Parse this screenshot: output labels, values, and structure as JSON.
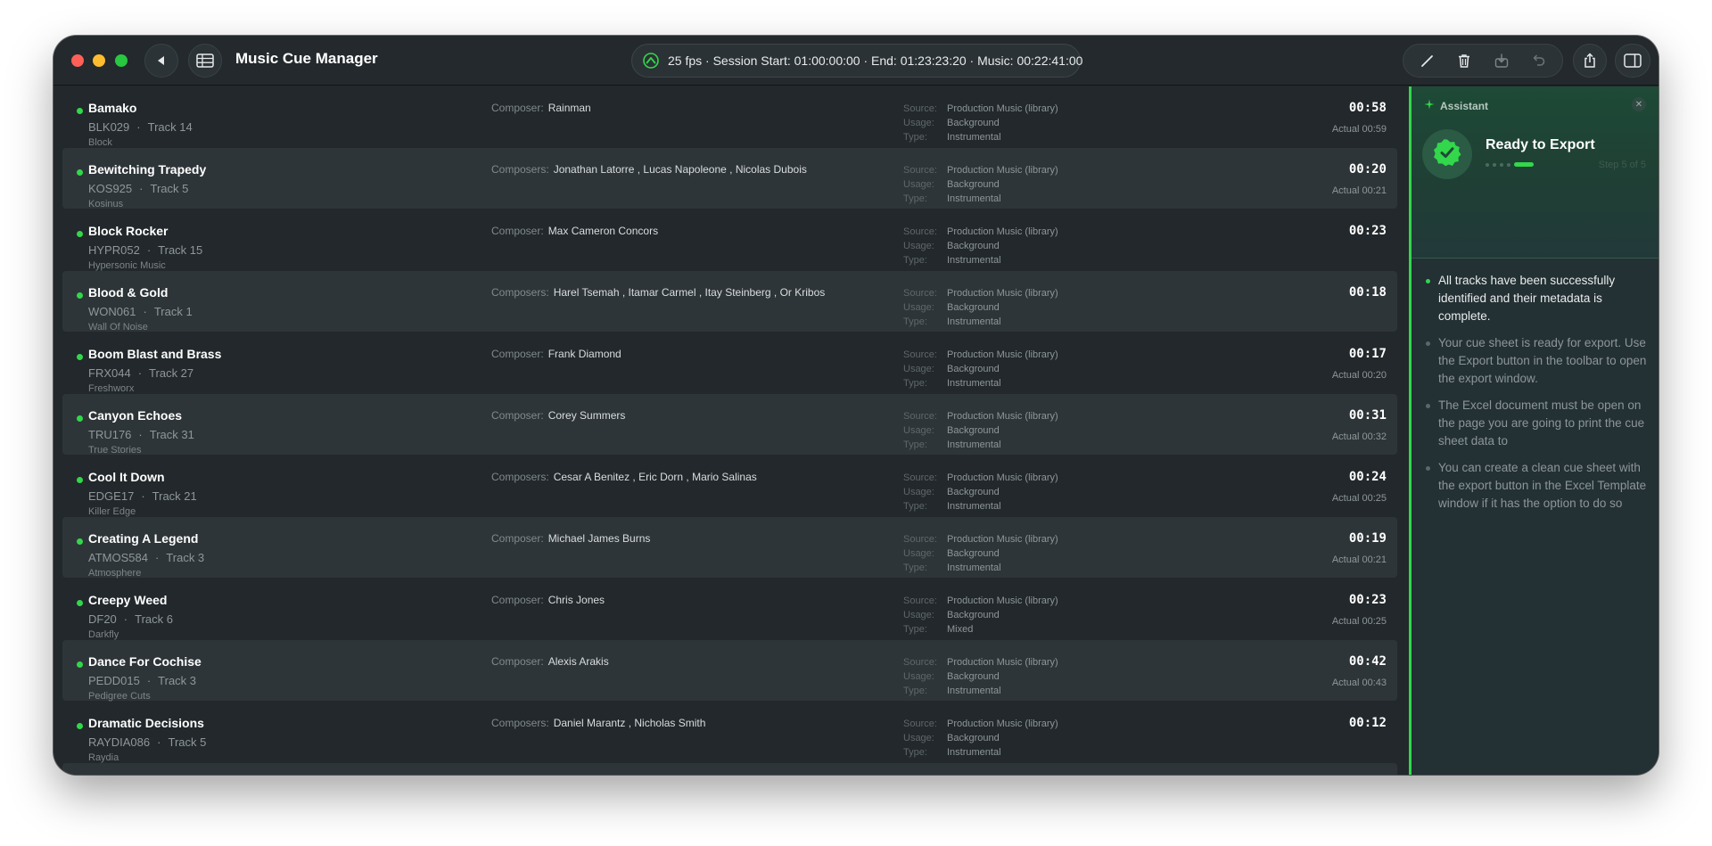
{
  "app": {
    "title": "Music Cue Manager"
  },
  "session": {
    "info": "25 fps · Session Start: 01:00:00:00 · End: 01:23:23:20 · Music: 00:22:41:00"
  },
  "colors": {
    "accent": "#32d74b",
    "background": "#22282b",
    "panel": "#233034"
  },
  "toolbar_icons": [
    "back-icon",
    "table-icon",
    "pencil-icon",
    "trash-icon",
    "import-icon",
    "undo-icon",
    "share-icon",
    "sidebar-icon"
  ],
  "labels": {
    "source": "Source:",
    "usage": "Usage:",
    "type": "Type:",
    "actual_prefix": "Actual"
  },
  "tracks": [
    {
      "title": "Bamako",
      "code": "BLK029",
      "track": "Track 14",
      "label": "Block",
      "composer_key": "Composer:",
      "composers": "Rainman",
      "source": "Production Music (library)",
      "usage": "Background",
      "type": "Instrumental",
      "duration": "00:58",
      "actual": "Actual 00:59"
    },
    {
      "title": "Bewitching Trapedy",
      "code": "KOS925",
      "track": "Track 5",
      "label": "Kosinus",
      "composer_key": "Composers:",
      "composers": "Jonathan Latorre , Lucas Napoleone , Nicolas Dubois",
      "source": "Production Music (library)",
      "usage": "Background",
      "type": "Instrumental",
      "duration": "00:20",
      "actual": "Actual 00:21"
    },
    {
      "title": "Block Rocker",
      "code": "HYPR052",
      "track": "Track 15",
      "label": "Hypersonic Music",
      "composer_key": "Composer:",
      "composers": "Max Cameron Concors",
      "source": "Production Music (library)",
      "usage": "Background",
      "type": "Instrumental",
      "duration": "00:23",
      "actual": ""
    },
    {
      "title": "Blood & Gold",
      "code": "WON061",
      "track": "Track 1",
      "label": "Wall Of Noise",
      "composer_key": "Composers:",
      "composers": "Harel Tsemah , Itamar Carmel , Itay Steinberg , Or Kribos",
      "source": "Production Music (library)",
      "usage": "Background",
      "type": "Instrumental",
      "duration": "00:18",
      "actual": ""
    },
    {
      "title": "Boom Blast and Brass",
      "code": "FRX044",
      "track": "Track 27",
      "label": "Freshworx",
      "composer_key": "Composer:",
      "composers": "Frank Diamond",
      "source": "Production Music (library)",
      "usage": "Background",
      "type": "Instrumental",
      "duration": "00:17",
      "actual": "Actual 00:20"
    },
    {
      "title": "Canyon Echoes",
      "code": "TRU176",
      "track": "Track 31",
      "label": "True Stories",
      "composer_key": "Composer:",
      "composers": "Corey Summers",
      "source": "Production Music (library)",
      "usage": "Background",
      "type": "Instrumental",
      "duration": "00:31",
      "actual": "Actual 00:32"
    },
    {
      "title": "Cool It Down",
      "code": "EDGE17",
      "track": "Track 21",
      "label": "Killer Edge",
      "composer_key": "Composers:",
      "composers": "Cesar A Benitez , Eric Dorn , Mario Salinas",
      "source": "Production Music (library)",
      "usage": "Background",
      "type": "Instrumental",
      "duration": "00:24",
      "actual": "Actual 00:25"
    },
    {
      "title": "Creating A Legend",
      "code": "ATMOS584",
      "track": "Track 3",
      "label": "Atmosphere",
      "composer_key": "Composer:",
      "composers": "Michael James Burns",
      "source": "Production Music (library)",
      "usage": "Background",
      "type": "Instrumental",
      "duration": "00:19",
      "actual": "Actual 00:21"
    },
    {
      "title": "Creepy Weed",
      "code": "DF20",
      "track": "Track 6",
      "label": "Darkfly",
      "composer_key": "Composer:",
      "composers": "Chris Jones",
      "source": "Production Music (library)",
      "usage": "Background",
      "type": "Mixed",
      "duration": "00:23",
      "actual": "Actual 00:25"
    },
    {
      "title": "Dance For Cochise",
      "code": "PEDD015",
      "track": "Track 3",
      "label": "Pedigree Cuts",
      "composer_key": "Composer:",
      "composers": "Alexis Arakis",
      "source": "Production Music (library)",
      "usage": "Background",
      "type": "Instrumental",
      "duration": "00:42",
      "actual": "Actual 00:43"
    },
    {
      "title": "Dramatic Decisions",
      "code": "RAYDIA086",
      "track": "Track 5",
      "label": "Raydia",
      "composer_key": "Composers:",
      "composers": "Daniel Marantz , Nicholas Smith",
      "source": "Production Music (library)",
      "usage": "Background",
      "type": "Instrumental",
      "duration": "00:12",
      "actual": ""
    }
  ],
  "assistant": {
    "header": "Assistant",
    "title": "Ready to Export",
    "step": "Step 5 of 5",
    "progress": 1.0,
    "notes": [
      "All tracks have been successfully identified and their metadata is complete.",
      "Your cue sheet is ready for export. Use the Export button in the toolbar to open the export window.",
      "The Excel document must be open on the page you are going to print the cue sheet data to",
      "You can create a clean cue sheet with the export button in the Excel Template window if it has the option to do so"
    ]
  }
}
